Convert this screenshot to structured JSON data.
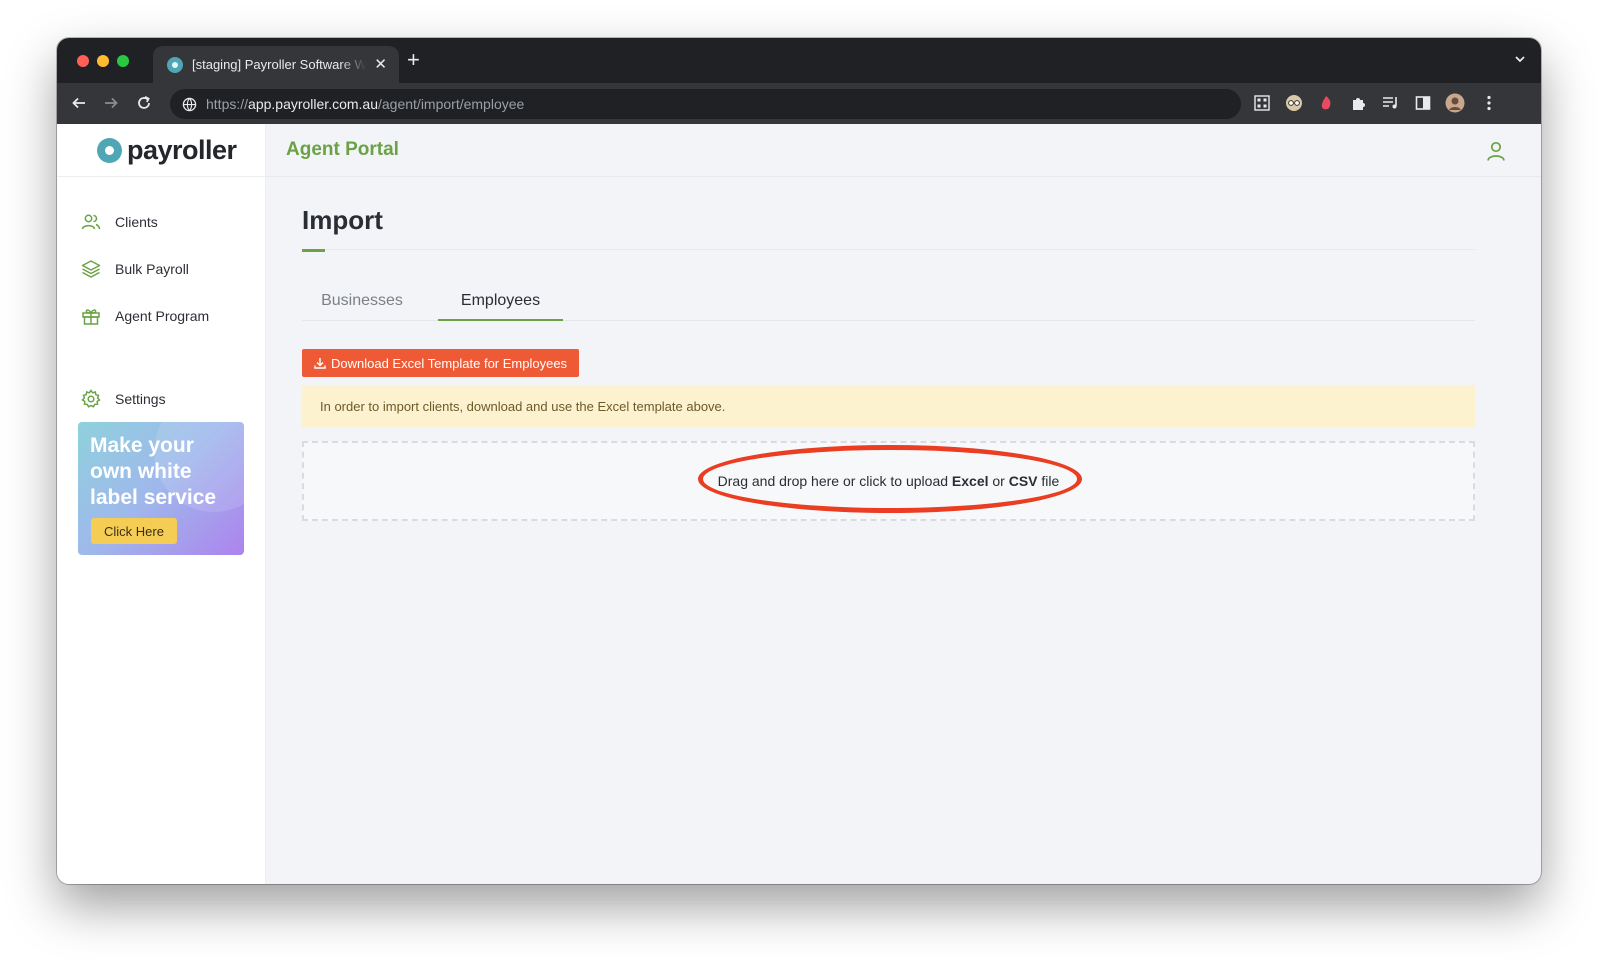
{
  "browser": {
    "tab_title": "[staging] Payroller Software Website",
    "url_scheme": "https://",
    "url_host": "app.payroller.com.au",
    "url_path": "/agent/import/employee"
  },
  "logo": {
    "text": "payroller"
  },
  "header": {
    "portal_title": "Agent Portal"
  },
  "sidebar": {
    "items": [
      {
        "label": "Clients",
        "icon": "users-icon"
      },
      {
        "label": "Bulk Payroll",
        "icon": "layers-icon"
      },
      {
        "label": "Agent Program",
        "icon": "gift-icon"
      },
      {
        "label": "Settings",
        "icon": "gear-icon"
      }
    ],
    "promo": {
      "title": "Make your own white label service",
      "button_label": "Click Here"
    }
  },
  "main": {
    "title": "Import",
    "tabs": [
      {
        "label": "Businesses",
        "active": false
      },
      {
        "label": "Employees",
        "active": true
      }
    ],
    "download_button": "Download Excel Template for Employees",
    "notice": "In order to import clients, download and use the Excel template above.",
    "dropzone": {
      "prefix": "Drag and drop here or click to upload ",
      "excel": "Excel",
      "or": " or ",
      "csv": "CSV",
      "suffix": " file"
    }
  },
  "colors": {
    "brand_green": "#6aa245",
    "brand_teal": "#4fa7b5",
    "download_orange": "#ef5a36",
    "annotation_red": "#ea3d21"
  }
}
